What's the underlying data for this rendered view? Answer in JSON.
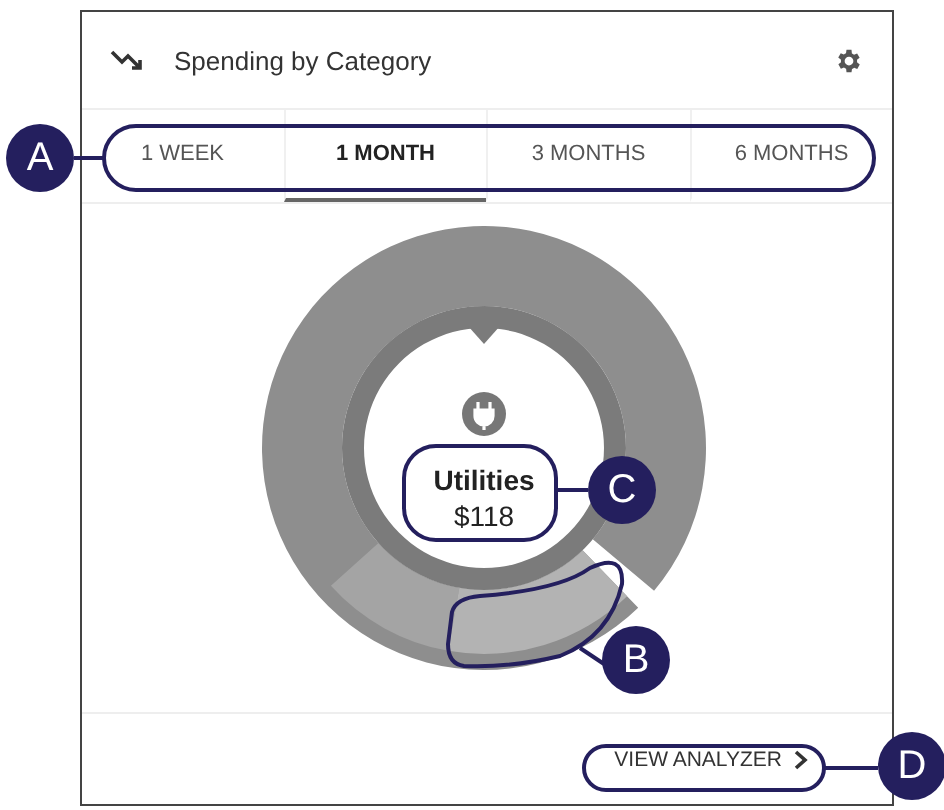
{
  "header": {
    "title": "Spending by Category"
  },
  "tabs": [
    {
      "label": "1 WEEK",
      "selected": false
    },
    {
      "label": "1 MONTH",
      "selected": true
    },
    {
      "label": "3 MONTHS",
      "selected": false
    },
    {
      "label": "6 MONTHS",
      "selected": false
    }
  ],
  "center": {
    "category": "Utilities",
    "amount": "$118"
  },
  "button": {
    "label": "VIEW ANALYZER"
  },
  "callouts": [
    {
      "label": "A"
    },
    {
      "label": "B"
    },
    {
      "label": "C"
    },
    {
      "label": "D"
    }
  ]
}
